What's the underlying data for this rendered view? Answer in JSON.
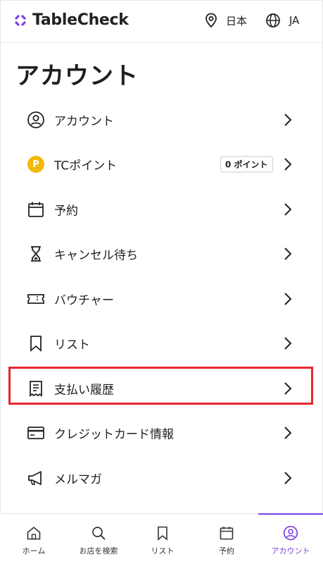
{
  "header": {
    "brand": "TableCheck",
    "region_label": "日本",
    "language_label": "JA"
  },
  "page": {
    "title": "アカウント"
  },
  "menu": [
    {
      "label": "アカウント",
      "icon": "user-circle-icon"
    },
    {
      "label": "TCポイント",
      "icon": "points-coin-icon",
      "badge": "0 ポイント"
    },
    {
      "label": "予約",
      "icon": "calendar-icon"
    },
    {
      "label": "キャンセル待ち",
      "icon": "hourglass-icon"
    },
    {
      "label": "バウチャー",
      "icon": "ticket-icon"
    },
    {
      "label": "リスト",
      "icon": "bookmark-icon"
    },
    {
      "label": "支払い履歴",
      "icon": "receipt-icon",
      "highlighted": true
    },
    {
      "label": "クレジットカード情報",
      "icon": "credit-card-icon"
    },
    {
      "label": "メルマガ",
      "icon": "megaphone-icon"
    }
  ],
  "points_coin_letter": "P",
  "tabs": [
    {
      "label": "ホーム",
      "icon": "home-icon"
    },
    {
      "label": "お店を検索",
      "icon": "search-icon"
    },
    {
      "label": "リスト",
      "icon": "bookmark-icon"
    },
    {
      "label": "予約",
      "icon": "calendar-icon"
    },
    {
      "label": "アカウント",
      "icon": "user-circle-icon",
      "active": true
    }
  ],
  "colors": {
    "accent": "#7b3fe4",
    "highlight_border": "#e6262e",
    "points_coin": "#f2b90d"
  }
}
